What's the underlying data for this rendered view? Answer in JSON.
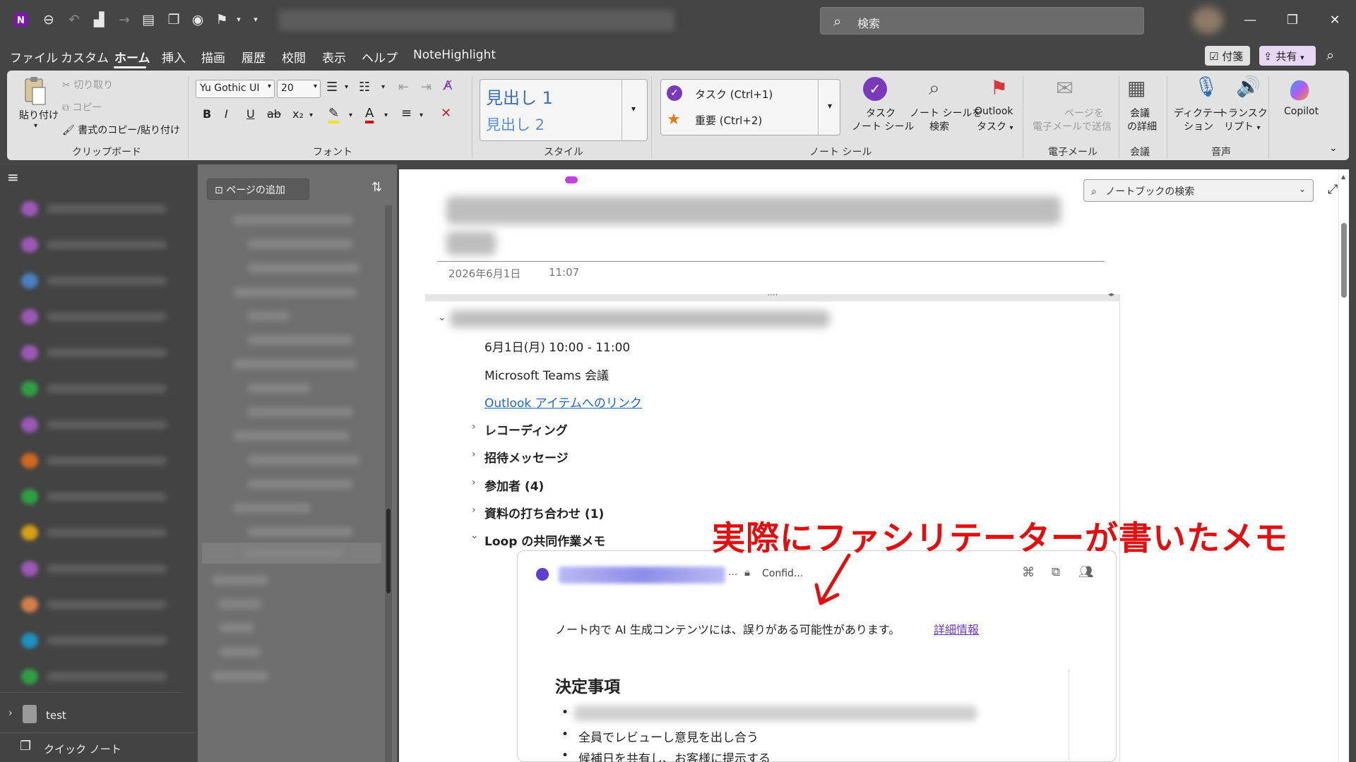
{
  "titlebar": {
    "search_placeholder": "検索",
    "window_controls": [
      "minimize-icon",
      "restore-icon",
      "close-icon"
    ]
  },
  "menu": {
    "items": [
      "ファイル",
      "カスタム",
      "ホーム",
      "挿入",
      "描画",
      "履歴",
      "校閲",
      "表示",
      "ヘルプ",
      "NoteHighlight"
    ],
    "active": "ホーム",
    "sticky_notes": "付箋",
    "share": "共有"
  },
  "ribbon": {
    "clipboard": {
      "paste": "貼り付け",
      "cut": "切り取り",
      "copy": "コピー",
      "format_painter": "書式のコピー/貼り付け",
      "group": "クリップボード"
    },
    "font": {
      "family": "Yu Gothic UI",
      "size": "20",
      "group": "フォント"
    },
    "styles": {
      "h1": "見出し 1",
      "h2": "見出し 2",
      "group": "スタイル"
    },
    "tags": {
      "task": "タスク (Ctrl+1)",
      "important": "重要 (Ctrl+2)",
      "task_tag_line1": "タスク",
      "task_tag_line2": "ノート シール",
      "find_tags_line1": "ノート シールを",
      "find_tags_line2": "検索",
      "outlook_line1": "Outlook",
      "outlook_line2": "タスク",
      "group": "ノート シール"
    },
    "email": {
      "line1": "ページを",
      "line2": "電子メールで送信",
      "group": "電子メール"
    },
    "meeting": {
      "line1": "会議",
      "line2": "の詳細",
      "group": "会議"
    },
    "voice": {
      "dictate_line1": "ディクテー",
      "dictate_line2": "ション",
      "transcribe_line1": "トランスク",
      "transcribe_line2": "リプト",
      "group": "音声"
    },
    "copilot": "Copilot"
  },
  "sidebar": {
    "notebook_colors": [
      "#9b59b6",
      "#9b59b6",
      "#4a7fc0",
      "#9b59b6",
      "#9b59b6",
      "#2ea043",
      "#9b59b6",
      "#d2691e",
      "#2ea043",
      "#d4a017",
      "#9b59b6",
      "#d2804a",
      "#1e90c0",
      "#2ea043"
    ],
    "test_notebook": "test",
    "quick_notes": "クイック ノート"
  },
  "pages_pane": {
    "add_page": "ページの追加"
  },
  "notebook_search": {
    "placeholder": "ノートブックの検索"
  },
  "page": {
    "date": "2026年6月1日",
    "time": "11:07",
    "meeting_time": "6月1日(月) 10:00 - 11:00",
    "meeting_type": "Microsoft Teams 会議",
    "outlook_link": "Outlook アイテムへのリンク",
    "sections": [
      "レコーディング",
      "招待メッセージ",
      "参加者 (4)",
      "資料の打ち合わせ (1)",
      "Loop の共同作業メモ"
    ]
  },
  "loop": {
    "confidential": "Confid...",
    "ai_notice": "ノート内で AI 生成コンテンツには、誤りがある可能性があります。",
    "more_info": "詳細情報",
    "decisions_heading": "決定事項",
    "bullets": [
      "全員でレビューし意見を出し合う",
      "候補日を共有し、お客様に提示する"
    ]
  },
  "annotation": "実際にファシリテーターが書いたメモ"
}
